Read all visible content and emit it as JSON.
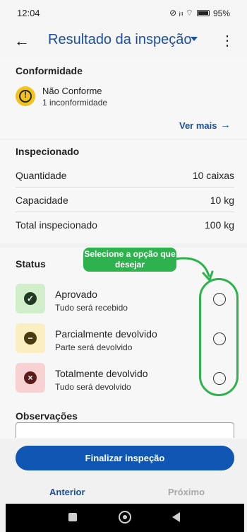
{
  "status_bar": {
    "time": "12:04",
    "icons": "⊘ ᵢₗₗ ⌔",
    "battery": "95%"
  },
  "app_bar": {
    "title": "Resultado da inspeção",
    "back_icon": "arrow-left-icon",
    "menu_icon": "more-vertical-icon"
  },
  "conformidade": {
    "heading": "Conformidade",
    "icon": "warning-icon",
    "icon_glyph": "!",
    "status": "Não Conforme",
    "detail": "1 inconformidade",
    "link": "Ver mais",
    "link_arrow": "→",
    "accent_color": "#f2c318"
  },
  "inspecionado": {
    "heading": "Inspecionado",
    "rows": [
      {
        "label": "Quantidade",
        "value": "10 caixas"
      },
      {
        "label": "Capacidade",
        "value": "10 kg"
      },
      {
        "label": "Total inspecionado",
        "value": "100 kg"
      }
    ]
  },
  "status": {
    "heading": "Status",
    "callout": "Selecione a opção que desejar",
    "highlight_color": "#2db24d",
    "options": [
      {
        "title": "Aprovado",
        "subtitle": "Tudo será recebido",
        "icon": "check-circle-icon",
        "glyph": "✓"
      },
      {
        "title": "Parcialmente devolvido",
        "subtitle": "Parte será devolvido",
        "icon": "minus-circle-icon",
        "glyph": "−"
      },
      {
        "title": "Totalmente devolvido",
        "subtitle": "Tudo será devolvido",
        "icon": "x-circle-icon",
        "glyph": "×"
      }
    ]
  },
  "observacoes": {
    "heading": "Observações",
    "value": ""
  },
  "actions": {
    "finish": "Finalizar inspeção",
    "prev": "Anterior",
    "next": "Próximo"
  },
  "colors": {
    "primary": "#0f56b3",
    "title": "#1a4fa0"
  }
}
